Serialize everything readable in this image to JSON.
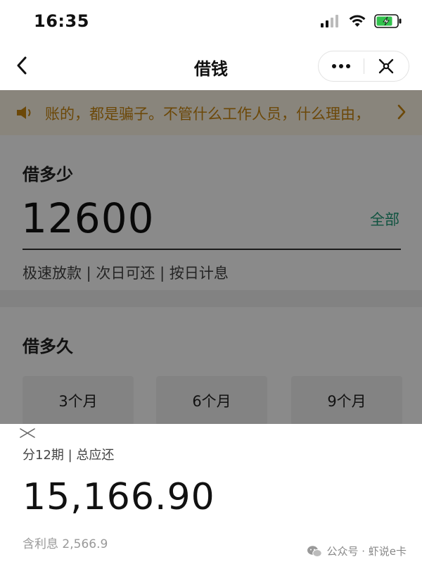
{
  "status": {
    "time": "16:35"
  },
  "nav": {
    "title": "借钱",
    "more_icon": "more-dots-icon",
    "close_icon": "close-icon"
  },
  "notice": {
    "text": "账的，都是骗子。不管什么工作人员，什么理由，",
    "icon": "speaker-icon"
  },
  "amount": {
    "label": "借多少",
    "value": "12600",
    "all_label": "全部",
    "tags": "极速放款 | 次日可还 | 按日计息"
  },
  "term": {
    "label": "借多久",
    "options": [
      "3个月",
      "6个月",
      "9个月"
    ]
  },
  "sheet": {
    "subtitle": "分12期 | 总应还",
    "total": "15,166.90",
    "interest": "含利息 2,566.9"
  },
  "watermark": {
    "text": "公众号 · 虾说e卡"
  },
  "colors": {
    "accent_green": "#1f9a77",
    "notice_orange": "#c8860f",
    "notice_bg": "#fdf5e6"
  }
}
